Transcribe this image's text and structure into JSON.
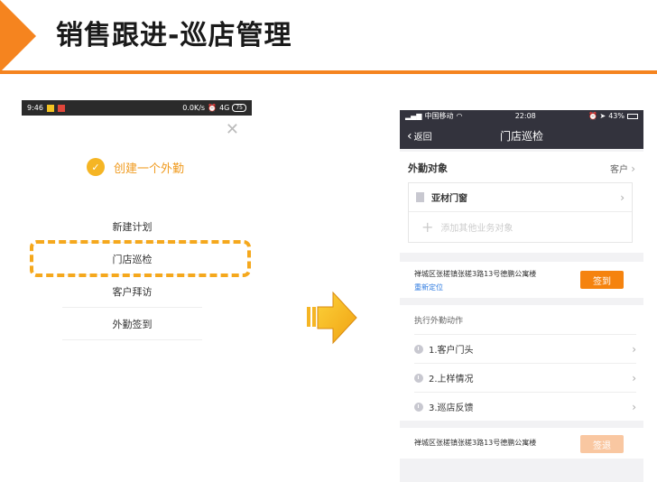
{
  "slide": {
    "title": "销售跟进-巡店管理"
  },
  "left_phone": {
    "status": {
      "time": "9:46",
      "net": "0.0K/s",
      "signal": "4G",
      "battery": "75"
    },
    "close_label": "✕",
    "create_label": "创建一个外勤",
    "menu": [
      {
        "label": "新建计划"
      },
      {
        "label": "门店巡检"
      },
      {
        "label": "客户拜访"
      },
      {
        "label": "外勤签到"
      }
    ]
  },
  "right_phone": {
    "status": {
      "carrier": "中国移动",
      "time": "22:08",
      "battery": "43%"
    },
    "nav": {
      "back_label": "返回",
      "title": "门店巡检"
    },
    "target": {
      "label": "外勤对象",
      "value": "客户",
      "store": "亚材门窗",
      "add_placeholder": "添加其他业务对象"
    },
    "checkin": {
      "address": "禅城区张槎镇张槎3路13号德鹏公寓楼",
      "relocate": "重新定位",
      "button": "签到"
    },
    "actions": {
      "header": "执行外勤动作",
      "items": [
        {
          "label": "1.客户门头"
        },
        {
          "label": "2.上样情况"
        },
        {
          "label": "3.巡店反馈"
        }
      ]
    },
    "checkout": {
      "address": "禅城区张槎镇张槎3路13号德鹏公寓楼",
      "button": "签退"
    }
  },
  "colors": {
    "accent": "#f5841f",
    "highlight": "#f5a81d",
    "dark_bar": "#33333d"
  }
}
